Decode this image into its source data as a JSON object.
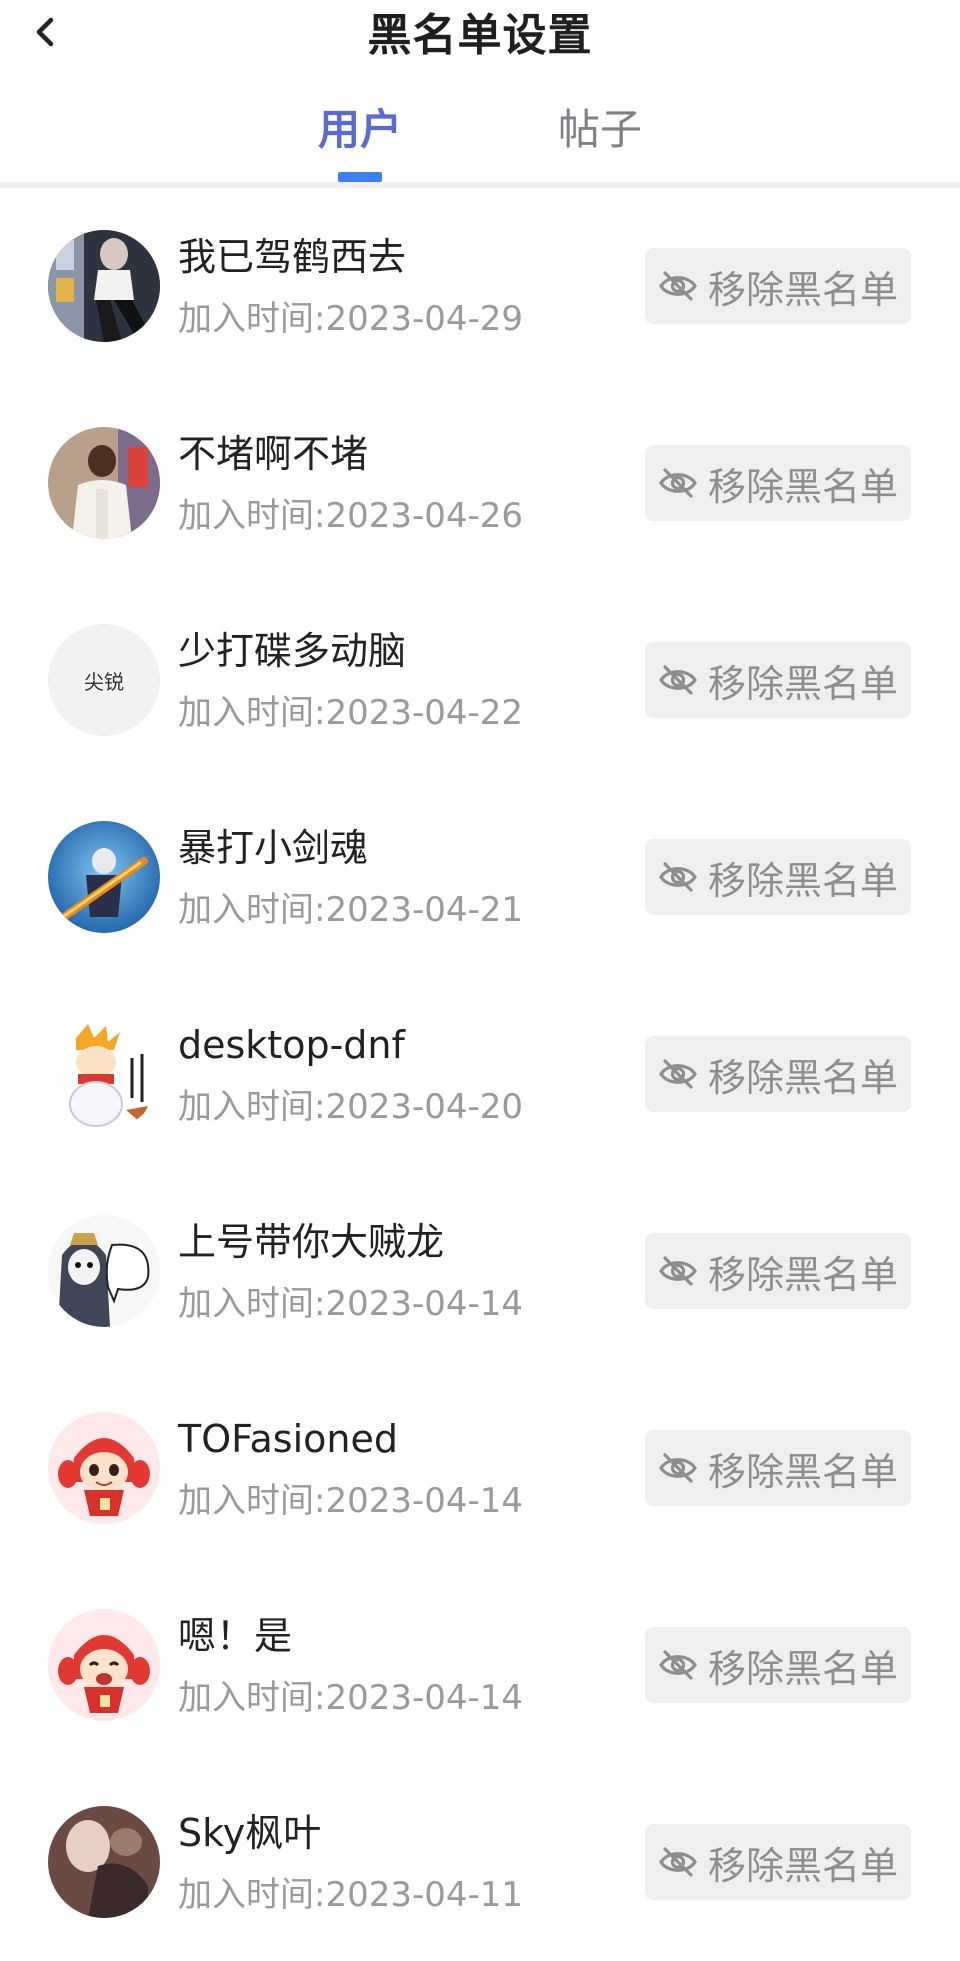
{
  "header": {
    "title": "黑名单设置",
    "back_icon": "chevron-left-icon"
  },
  "tabs": [
    {
      "label": "用户",
      "active": true
    },
    {
      "label": "帖子",
      "active": false
    }
  ],
  "colors": {
    "active_tab": "#5b6bd1",
    "indicator": "#3d80f6",
    "button_bg": "#efefef",
    "button_text": "#8e8e8e",
    "secondary_text": "#9a9a9a"
  },
  "list": {
    "remove_label": "移除黑名单",
    "remove_icon": "eye-off-icon",
    "items": [
      {
        "name": "我已驾鹤西去",
        "joined": "加入时间:2023-04-29",
        "avatar": "photo"
      },
      {
        "name": "不堵啊不堵",
        "joined": "加入时间:2023-04-26",
        "avatar": "photo"
      },
      {
        "name": "少打碟多动脑",
        "joined": "加入时间:2023-04-22",
        "avatar_text": "尖锐"
      },
      {
        "name": "暴打小剑魂",
        "joined": "加入时间:2023-04-21",
        "avatar": "photo"
      },
      {
        "name": "desktop-dnf",
        "joined": "加入时间:2023-04-20",
        "avatar": "illustration"
      },
      {
        "name": "上号带你大贼龙",
        "joined": "加入时间:2023-04-14",
        "avatar": "illustration"
      },
      {
        "name": "TOFasioned",
        "joined": "加入时间:2023-04-14",
        "avatar": "illustration"
      },
      {
        "name": "嗯！是",
        "joined": "加入时间:2023-04-14",
        "avatar": "illustration"
      },
      {
        "name": "Sky枫叶",
        "joined": "加入时间:2023-04-11",
        "avatar": "photo"
      }
    ]
  }
}
